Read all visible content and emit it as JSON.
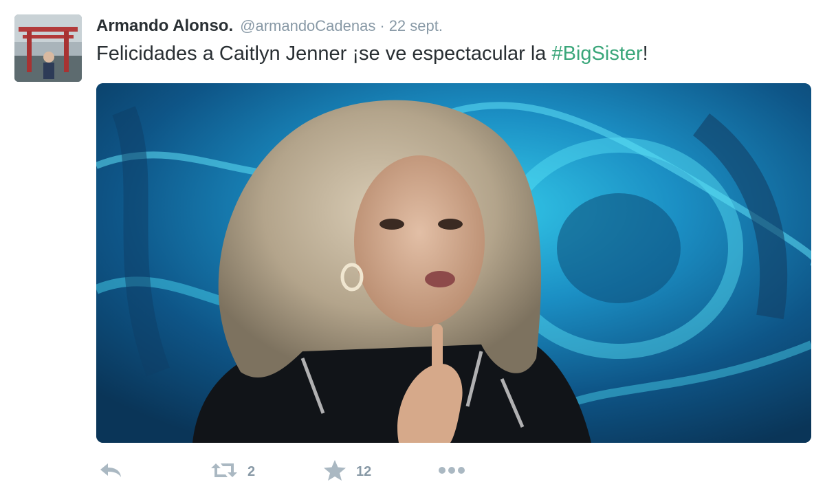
{
  "tweet": {
    "author_name": "Armando Alonso.",
    "handle": "@armandoCadenas",
    "separator": "·",
    "date": "22 sept.",
    "text_before": "Felicidades a Caitlyn Jenner  ¡se ve espectacular la ",
    "hashtag": "#BigSister",
    "text_after": "!"
  },
  "actions": {
    "reply_icon": "reply-icon",
    "retweet_icon": "retweet-icon",
    "retweet_count": "2",
    "favorite_icon": "star-icon",
    "favorite_count": "12",
    "more_icon": "more-dots-icon"
  },
  "colors": {
    "name": "#292f33",
    "meta": "#8899a6",
    "hashtag": "#3aa67a",
    "action_icon": "#aab8c2"
  }
}
